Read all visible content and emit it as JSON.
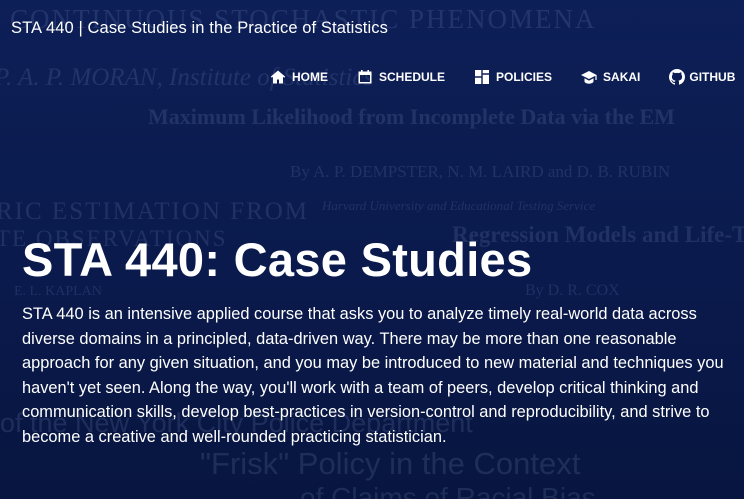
{
  "header": {
    "title": "STA 440 | Case Studies in the Practice of Statistics"
  },
  "nav": {
    "items": [
      {
        "label": "HOME",
        "icon": "home-icon"
      },
      {
        "label": "SCHEDULE",
        "icon": "calendar-icon"
      },
      {
        "label": "POLICIES",
        "icon": "grid-icon"
      },
      {
        "label": "SAKAI",
        "icon": "graduation-cap-icon"
      },
      {
        "label": "GITHUB",
        "icon": "github-icon"
      }
    ]
  },
  "hero": {
    "title": "STA 440: Case Studies",
    "description": "STA 440 is an intensive applied course that asks you to analyze timely real-world data across diverse domains in a principled, data-driven way. There may be more than one reasonable approach for any given situation, and you may be introduced to new material and techniques you haven't yet seen. Along the way, you'll work with a team of peers, develop critical thinking and communication skills, develop best-practices in version-control and reproducibility, and strive to become a creative and well-rounded practicing statistician."
  },
  "background": {
    "lines": [
      "CONTINUOUS STOCHASTIC PHENOMENA",
      "P. A. P. MORAN, Institute of Statistics",
      "Maximum Likelihood from Incomplete Data via the EM",
      "By A. P. DEMPSTER, N. M. LAIRD and D. B. RUBIN",
      "RIC ESTIMATION FROM",
      "Harvard University and Educational Testing Service",
      "Regression Models and Life-Tables",
      "TE OBSERVATIONS",
      "By D. R. COX",
      "E. L. KAPLAN",
      "of the New York City Police Department",
      "\"Frisk\" Policy in the Context",
      "of Claims of Racial Bias"
    ]
  }
}
